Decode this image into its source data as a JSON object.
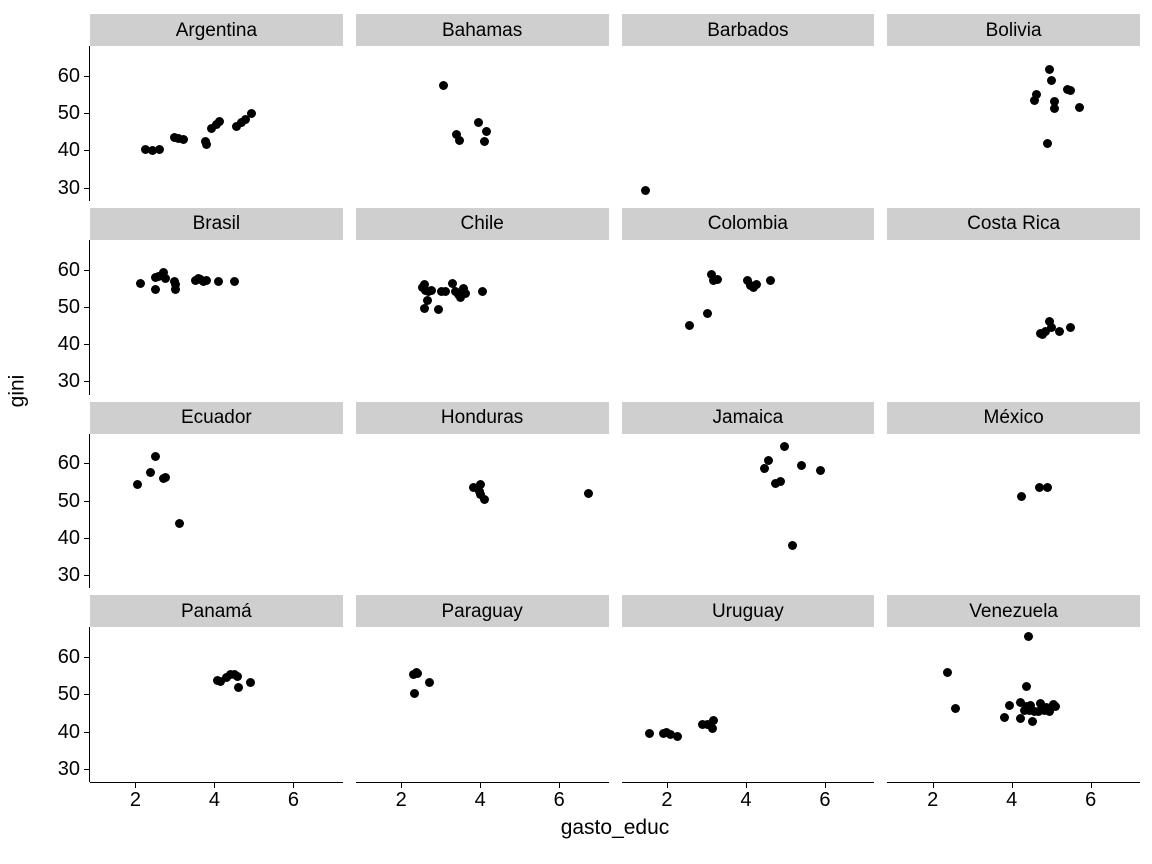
{
  "chart_data": {
    "type": "scatter",
    "title": "",
    "xlabel": "gasto_educ",
    "ylabel": "gini",
    "xlim": [
      0.85,
      7.25
    ],
    "ylim": [
      26.5,
      68.0
    ],
    "xticks": [
      2,
      4,
      6
    ],
    "yticks": [
      30,
      40,
      50,
      60
    ],
    "grid": false,
    "legend": null,
    "facet_variable": "pais",
    "facet_layout": {
      "rows": 4,
      "cols": 4
    },
    "point_color": "#000000",
    "strip_background": "#cfcfcf",
    "panel_background": "#ffffff",
    "panels": [
      {
        "label": "Argentina",
        "points": [
          {
            "x": 2.25,
            "y": 40.2
          },
          {
            "x": 2.42,
            "y": 40.1
          },
          {
            "x": 2.6,
            "y": 40.3
          },
          {
            "x": 3.0,
            "y": 43.4
          },
          {
            "x": 3.1,
            "y": 43.2
          },
          {
            "x": 3.22,
            "y": 42.9
          },
          {
            "x": 3.78,
            "y": 42.3
          },
          {
            "x": 3.8,
            "y": 41.6
          },
          {
            "x": 3.93,
            "y": 45.8
          },
          {
            "x": 4.05,
            "y": 47.0
          },
          {
            "x": 4.12,
            "y": 47.7
          },
          {
            "x": 4.55,
            "y": 46.5
          },
          {
            "x": 4.68,
            "y": 47.6
          },
          {
            "x": 4.78,
            "y": 48.2
          },
          {
            "x": 4.95,
            "y": 49.9
          }
        ]
      },
      {
        "label": "Bahamas",
        "points": [
          {
            "x": 3.08,
            "y": 57.5
          },
          {
            "x": 3.4,
            "y": 44.4
          },
          {
            "x": 3.48,
            "y": 42.6
          },
          {
            "x": 3.95,
            "y": 47.6
          },
          {
            "x": 4.17,
            "y": 45.1
          },
          {
            "x": 4.12,
            "y": 42.4
          }
        ]
      },
      {
        "label": "Barbados",
        "points": [
          {
            "x": 1.45,
            "y": 29.2
          }
        ]
      },
      {
        "label": "Bolivia",
        "points": [
          {
            "x": 4.95,
            "y": 61.6
          },
          {
            "x": 5.02,
            "y": 58.8
          },
          {
            "x": 5.42,
            "y": 56.3
          },
          {
            "x": 5.5,
            "y": 56.2
          },
          {
            "x": 4.62,
            "y": 55.0
          },
          {
            "x": 4.58,
            "y": 53.5
          },
          {
            "x": 5.08,
            "y": 53.2
          },
          {
            "x": 5.08,
            "y": 51.3
          },
          {
            "x": 5.72,
            "y": 51.5
          },
          {
            "x": 4.92,
            "y": 41.9
          }
        ]
      },
      {
        "label": "Brasil",
        "points": [
          {
            "x": 2.12,
            "y": 56.2
          },
          {
            "x": 2.52,
            "y": 57.8
          },
          {
            "x": 2.58,
            "y": 58.2
          },
          {
            "x": 2.7,
            "y": 59.2
          },
          {
            "x": 2.76,
            "y": 57.5
          },
          {
            "x": 2.52,
            "y": 54.7
          },
          {
            "x": 2.98,
            "y": 56.8
          },
          {
            "x": 3.02,
            "y": 56.0
          },
          {
            "x": 3.02,
            "y": 54.6
          },
          {
            "x": 3.52,
            "y": 57.1
          },
          {
            "x": 3.6,
            "y": 57.5
          },
          {
            "x": 3.66,
            "y": 57.3
          },
          {
            "x": 3.72,
            "y": 56.8
          },
          {
            "x": 3.8,
            "y": 57.0
          },
          {
            "x": 4.1,
            "y": 56.7
          },
          {
            "x": 4.52,
            "y": 56.8
          }
        ]
      },
      {
        "label": "Chile",
        "points": [
          {
            "x": 2.6,
            "y": 56.0
          },
          {
            "x": 2.55,
            "y": 55.2
          },
          {
            "x": 2.62,
            "y": 54.3
          },
          {
            "x": 2.7,
            "y": 54.0
          },
          {
            "x": 2.78,
            "y": 54.4
          },
          {
            "x": 2.66,
            "y": 51.8
          },
          {
            "x": 2.58,
            "y": 49.5
          },
          {
            "x": 3.02,
            "y": 54.2
          },
          {
            "x": 3.12,
            "y": 54.1
          },
          {
            "x": 2.95,
            "y": 49.3
          },
          {
            "x": 3.3,
            "y": 56.3
          },
          {
            "x": 3.38,
            "y": 54.0
          },
          {
            "x": 3.45,
            "y": 53.2
          },
          {
            "x": 3.5,
            "y": 52.5
          },
          {
            "x": 3.58,
            "y": 54.8
          },
          {
            "x": 3.62,
            "y": 53.6
          },
          {
            "x": 4.05,
            "y": 54.0
          }
        ]
      },
      {
        "label": "Colombia",
        "points": [
          {
            "x": 3.12,
            "y": 58.6
          },
          {
            "x": 3.18,
            "y": 57.0
          },
          {
            "x": 3.28,
            "y": 57.3
          },
          {
            "x": 4.05,
            "y": 57.1
          },
          {
            "x": 4.12,
            "y": 55.8
          },
          {
            "x": 4.18,
            "y": 55.2
          },
          {
            "x": 4.28,
            "y": 56.0
          },
          {
            "x": 4.62,
            "y": 57.2
          },
          {
            "x": 3.02,
            "y": 48.3
          },
          {
            "x": 2.58,
            "y": 45.0
          }
        ]
      },
      {
        "label": "Costa Rica",
        "points": [
          {
            "x": 4.72,
            "y": 42.9
          },
          {
            "x": 4.78,
            "y": 42.7
          },
          {
            "x": 4.85,
            "y": 43.5
          },
          {
            "x": 4.96,
            "y": 46.2
          },
          {
            "x": 5.02,
            "y": 44.6
          },
          {
            "x": 5.22,
            "y": 43.4
          },
          {
            "x": 5.48,
            "y": 44.6
          }
        ]
      },
      {
        "label": "Ecuador",
        "points": [
          {
            "x": 2.52,
            "y": 61.8
          },
          {
            "x": 2.38,
            "y": 57.5
          },
          {
            "x": 2.7,
            "y": 55.8
          },
          {
            "x": 2.76,
            "y": 56.2
          },
          {
            "x": 2.05,
            "y": 54.2
          },
          {
            "x": 3.12,
            "y": 43.8
          }
        ]
      },
      {
        "label": "Honduras",
        "points": [
          {
            "x": 3.82,
            "y": 53.6
          },
          {
            "x": 4.0,
            "y": 54.4
          },
          {
            "x": 3.98,
            "y": 52.5
          },
          {
            "x": 4.0,
            "y": 51.6
          },
          {
            "x": 4.12,
            "y": 50.2
          },
          {
            "x": 6.75,
            "y": 52.0
          }
        ]
      },
      {
        "label": "Jamaica",
        "points": [
          {
            "x": 4.98,
            "y": 64.6
          },
          {
            "x": 4.58,
            "y": 60.8
          },
          {
            "x": 4.48,
            "y": 58.6
          },
          {
            "x": 5.42,
            "y": 59.5
          },
          {
            "x": 5.88,
            "y": 58.2
          },
          {
            "x": 4.75,
            "y": 54.6
          },
          {
            "x": 4.88,
            "y": 55.2
          },
          {
            "x": 5.18,
            "y": 37.9
          }
        ]
      },
      {
        "label": "México",
        "points": [
          {
            "x": 4.25,
            "y": 51.2
          },
          {
            "x": 4.7,
            "y": 53.4
          },
          {
            "x": 4.92,
            "y": 53.4
          }
        ]
      },
      {
        "label": "Panamá",
        "points": [
          {
            "x": 4.08,
            "y": 53.8
          },
          {
            "x": 4.16,
            "y": 53.5
          },
          {
            "x": 4.3,
            "y": 54.5
          },
          {
            "x": 4.4,
            "y": 55.3
          },
          {
            "x": 4.5,
            "y": 55.4
          },
          {
            "x": 4.58,
            "y": 54.8
          },
          {
            "x": 4.62,
            "y": 51.9
          },
          {
            "x": 4.92,
            "y": 53.2
          }
        ]
      },
      {
        "label": "Paraguay",
        "points": [
          {
            "x": 2.32,
            "y": 55.4
          },
          {
            "x": 2.38,
            "y": 55.8
          },
          {
            "x": 2.42,
            "y": 55.6
          },
          {
            "x": 2.35,
            "y": 50.2
          },
          {
            "x": 2.72,
            "y": 53.3
          }
        ]
      },
      {
        "label": "Uruguay",
        "points": [
          {
            "x": 1.55,
            "y": 39.6
          },
          {
            "x": 1.92,
            "y": 39.5
          },
          {
            "x": 2.0,
            "y": 39.8
          },
          {
            "x": 2.08,
            "y": 39.2
          },
          {
            "x": 2.28,
            "y": 38.7
          },
          {
            "x": 2.9,
            "y": 42.0
          },
          {
            "x": 3.02,
            "y": 41.9
          },
          {
            "x": 3.18,
            "y": 43.1
          },
          {
            "x": 3.15,
            "y": 40.8
          }
        ]
      },
      {
        "label": "Venezuela",
        "points": [
          {
            "x": 4.42,
            "y": 65.4
          },
          {
            "x": 2.38,
            "y": 55.9
          },
          {
            "x": 4.38,
            "y": 52.2
          },
          {
            "x": 2.58,
            "y": 46.3
          },
          {
            "x": 3.95,
            "y": 47.0
          },
          {
            "x": 4.22,
            "y": 47.8
          },
          {
            "x": 4.38,
            "y": 46.8
          },
          {
            "x": 4.48,
            "y": 47.0
          },
          {
            "x": 4.72,
            "y": 47.6
          },
          {
            "x": 4.88,
            "y": 46.6
          },
          {
            "x": 5.05,
            "y": 47.2
          },
          {
            "x": 4.32,
            "y": 45.8
          },
          {
            "x": 4.45,
            "y": 45.6
          },
          {
            "x": 4.58,
            "y": 45.5
          },
          {
            "x": 4.68,
            "y": 45.4
          },
          {
            "x": 4.82,
            "y": 45.6
          },
          {
            "x": 4.95,
            "y": 45.3
          },
          {
            "x": 5.12,
            "y": 46.8
          },
          {
            "x": 3.82,
            "y": 43.8
          },
          {
            "x": 4.22,
            "y": 43.6
          },
          {
            "x": 4.52,
            "y": 42.8
          }
        ]
      }
    ]
  },
  "axis": {
    "x_title": "gasto_educ",
    "y_title": "gini",
    "x_tick_labels": [
      "2",
      "4",
      "6"
    ],
    "y_tick_labels": [
      "30",
      "40",
      "50",
      "60"
    ]
  }
}
